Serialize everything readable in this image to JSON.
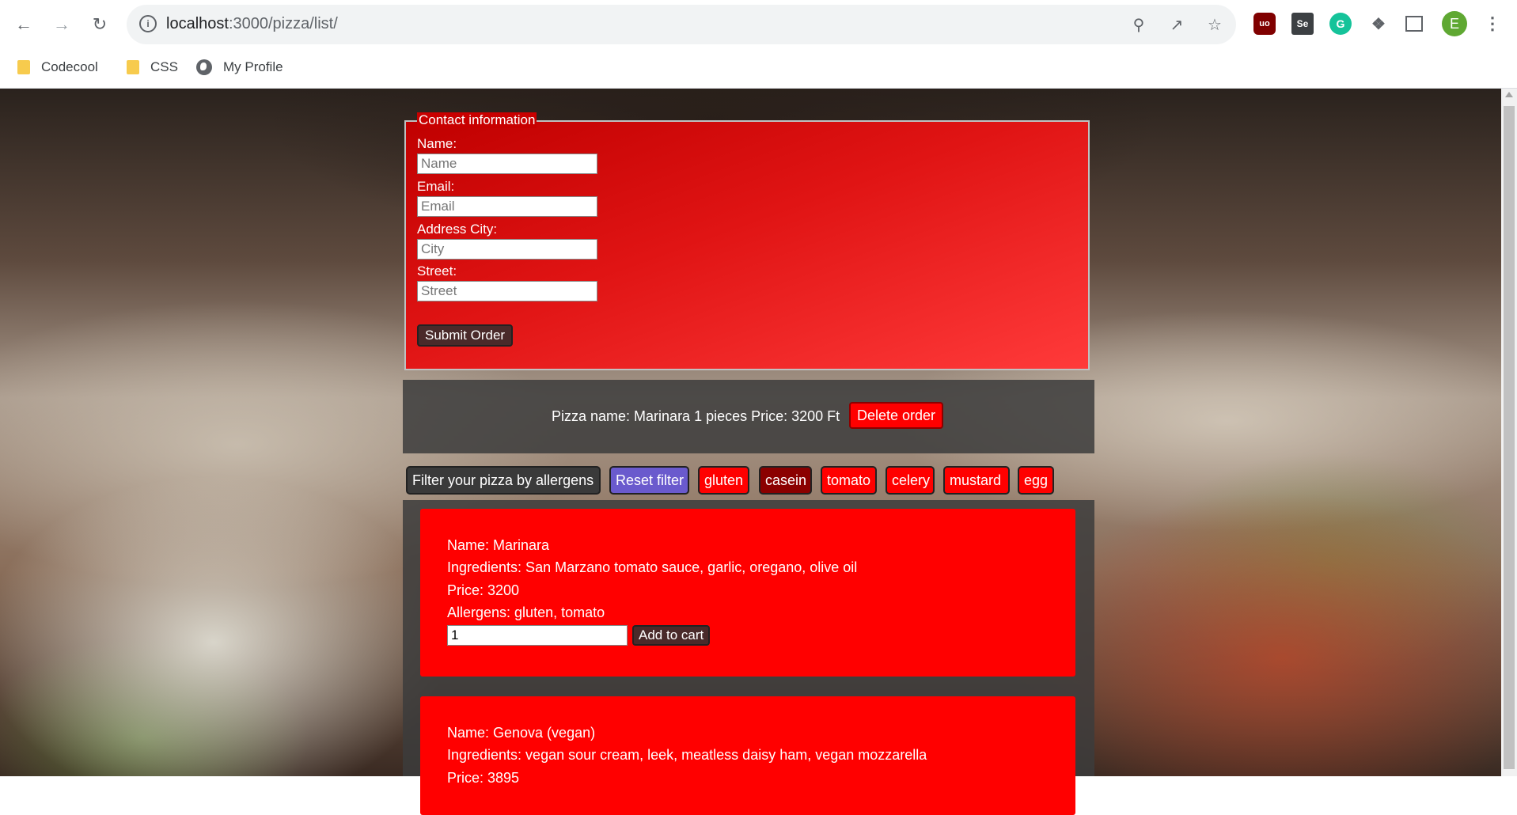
{
  "browser": {
    "url_host": "localhost",
    "url_path": ":3000/pizza/list/",
    "bookmarks": [
      "Codecool",
      "CSS",
      "My Profile"
    ],
    "profile_initial": "E",
    "ext_ublock": "uo",
    "ext_se": "Se",
    "ext_grammarly": "G"
  },
  "contact": {
    "legend": "Contact information",
    "name_label": "Name:",
    "name_placeholder": "Name",
    "email_label": "Email:",
    "email_placeholder": "Email",
    "city_label": "Address City:",
    "city_placeholder": "City",
    "street_label": "Street:",
    "street_placeholder": "Street",
    "submit_label": "Submit Order"
  },
  "order": {
    "text": "Pizza name: Marinara 1 pieces Price: 3200 Ft",
    "delete_label": "Delete order"
  },
  "filter": {
    "title": "Filter your pizza by allergens",
    "reset_label": "Reset filter",
    "allergens": [
      "gluten",
      "casein",
      "tomato",
      "celery",
      "mustard",
      "egg"
    ]
  },
  "pizzas": [
    {
      "name": "Name: Marinara",
      "ingredients": "Ingredients: San Marzano tomato sauce, garlic, oregano, olive oil",
      "price": "Price: 3200",
      "allergens": "Allergens: gluten, tomato",
      "qty": "1",
      "add_label": "Add to cart"
    },
    {
      "name": "Name: Genova (vegan)",
      "ingredients": "Ingredients: vegan sour cream, leek, meatless daisy ham, vegan mozzarella",
      "price": "Price: 3895"
    }
  ],
  "colors": {
    "accent_red": "#ff0000",
    "reset_blue": "#6a5acd",
    "casein_active": "#8b0000"
  }
}
